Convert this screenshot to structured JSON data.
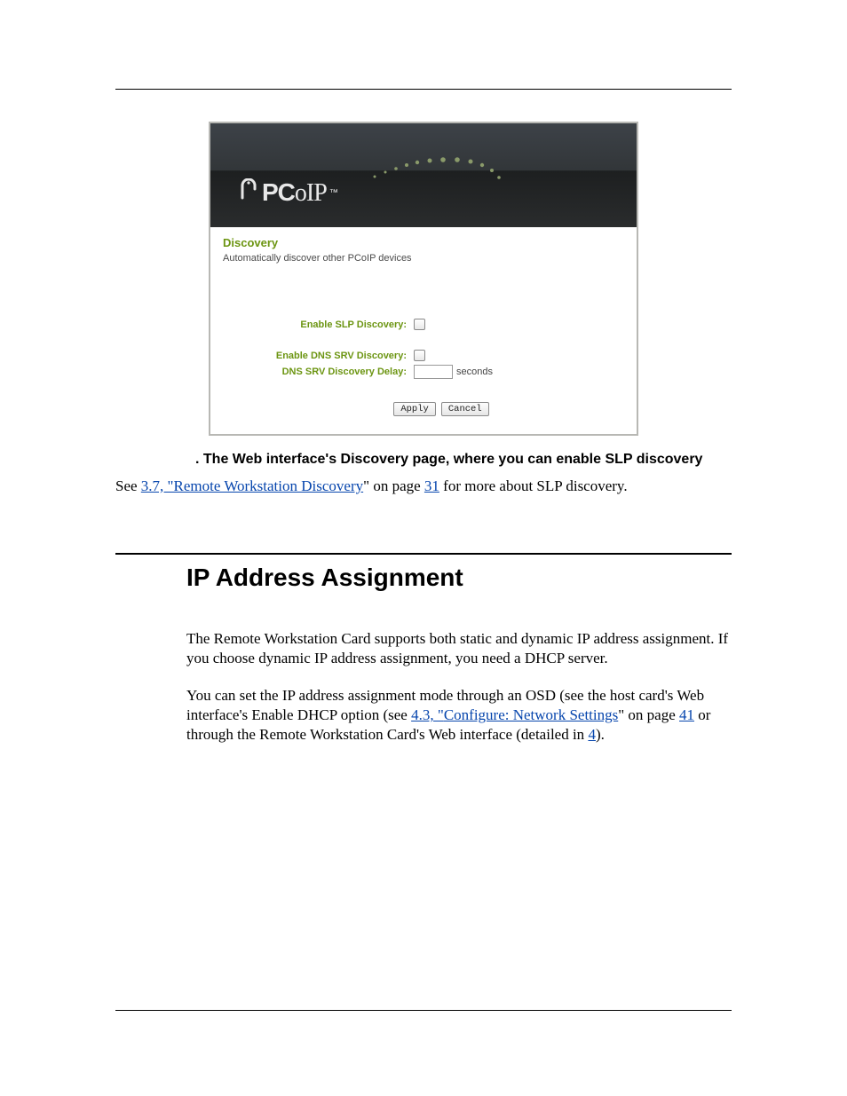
{
  "screenshot": {
    "logo_text": "PCoIP",
    "logo_tm": "™",
    "title": "Discovery",
    "subtitle": "Automatically discover other PCoIP devices",
    "fields": {
      "slp_label": "Enable SLP Discovery:",
      "dns_label": "Enable DNS SRV Discovery:",
      "delay_label": "DNS SRV Discovery Delay:",
      "delay_unit": "seconds"
    },
    "buttons": {
      "apply": "Apply",
      "cancel": "Cancel"
    }
  },
  "caption": ". The Web interface's Discovery page, where you can enable SLP discovery",
  "see_prefix": "See ",
  "see_link_open": "3.7, \"",
  "see_link_text": "Remote Workstation Discovery",
  "see_link_close": "\" on page ",
  "see_page": "31",
  "see_tail": " for more about SLP discovery.",
  "section": {
    "heading": "IP Address Assignment",
    "p1": "The Remote Workstation Card supports both static and dynamic IP address assignment. If you choose dynamic IP address assignment, you need a DHCP server.",
    "p2_a": "You can set the IP address assignment mode through an OSD (see the host card's Web interface's Enable DHCP option (see ",
    "p2_link_open": "4.3, \"",
    "p2_link_text": "Configure: Network Settings",
    "p2_link_close": "\" on page ",
    "p2_page": "41",
    "p2_b": " or through the Remote Workstation Card's Web interface (detailed in ",
    "p2_link2_text": "4",
    "p2_c": ")."
  }
}
